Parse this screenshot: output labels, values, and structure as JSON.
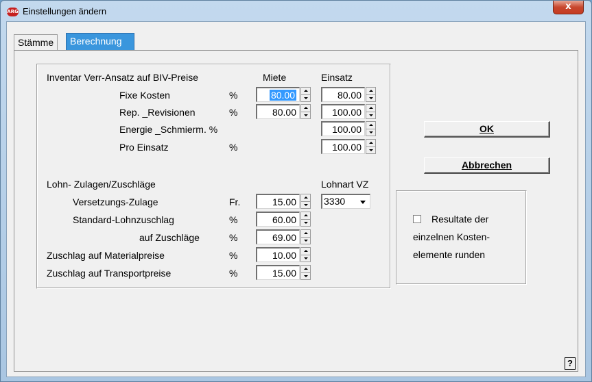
{
  "window": {
    "title": "Einstellungen ändern",
    "app_icon": "ARG",
    "close": "x"
  },
  "tabs": [
    "Stämme",
    "Berechnung"
  ],
  "inventar": {
    "heading": "Inventar Verr-Ansatz auf BIV-Preise",
    "col_miete": "Miete",
    "col_einsatz": "Einsatz",
    "rows": [
      {
        "label": "Fixe Kosten",
        "unit": "%",
        "miete": "80.00",
        "einsatz": "80.00"
      },
      {
        "label": "Rep. _Revisionen",
        "unit": "%",
        "miete": "80.00",
        "einsatz": "100.00"
      },
      {
        "label": "Energie _Schmierm. %",
        "unit": "",
        "miete": "",
        "einsatz": "100.00"
      },
      {
        "label": "Pro Einsatz",
        "unit": "%",
        "miete": "",
        "einsatz": "100.00"
      }
    ]
  },
  "lohn": {
    "heading": "Lohn- Zulagen/Zuschläge",
    "lohnart_label": "Lohnart VZ",
    "lohnart_value": "3330",
    "rows": [
      {
        "label": "Versetzungs-Zulage",
        "unit": "Fr.",
        "value": "15.00"
      },
      {
        "label": "Standard-Lohnzuschlag",
        "unit": "%",
        "value": "60.00"
      },
      {
        "label": "auf Zuschläge",
        "unit": "%",
        "value": "69.00"
      },
      {
        "label": "Zuschlag auf Materialpreise",
        "unit": "%",
        "value": "10.00"
      },
      {
        "label": "Zuschlag auf Transportpreise",
        "unit": "%",
        "value": "15.00"
      }
    ]
  },
  "buttons": {
    "ok_label": "OK",
    "cancel_label": "Abbrechen"
  },
  "options": {
    "round_lines": [
      "Resultate der",
      "einzelnen Kosten-",
      "elemente runden"
    ],
    "round_checked": false
  },
  "help": "?"
}
